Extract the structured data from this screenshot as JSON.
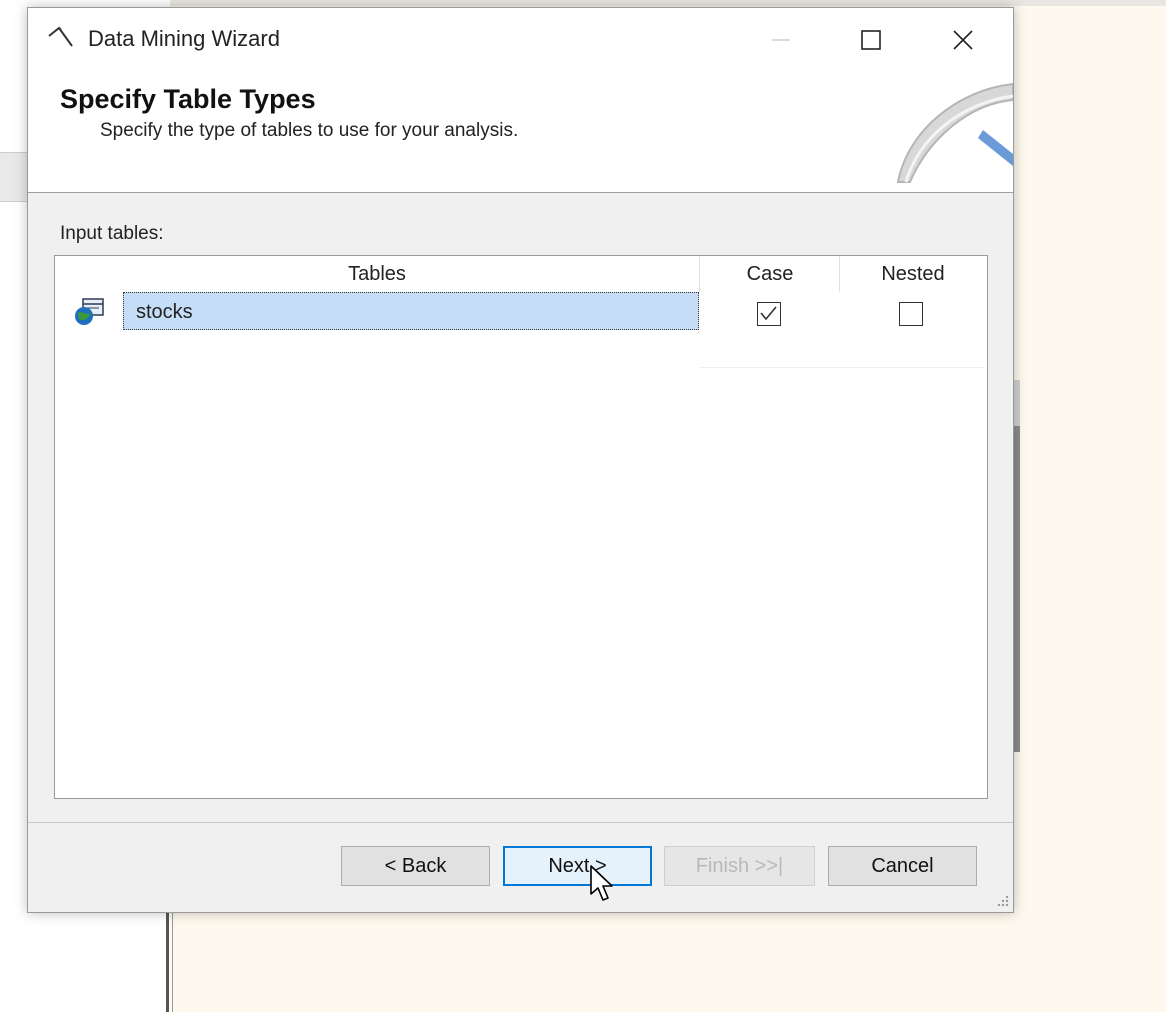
{
  "window": {
    "title": "Data Mining Wizard",
    "minimize_icon": "minimize-icon",
    "maximize_icon": "maximize-icon",
    "close_icon": "close-icon"
  },
  "header": {
    "title": "Specify Table Types",
    "subtitle": "Specify the type of tables to use for your analysis."
  },
  "input_tables": {
    "label": "Input tables:",
    "columns": [
      "Tables",
      "Case",
      "Nested"
    ],
    "rows": [
      {
        "table": "stocks",
        "case": true,
        "nested": false,
        "icon": "database-table-icon",
        "selected": true
      }
    ]
  },
  "buttons": {
    "back": "< Back",
    "next": "Next >",
    "finish": "Finish >>|",
    "cancel": "Cancel",
    "finish_enabled": false
  },
  "colors": {
    "selection": "#c6ddf7",
    "focus_border": "#0078d7"
  }
}
